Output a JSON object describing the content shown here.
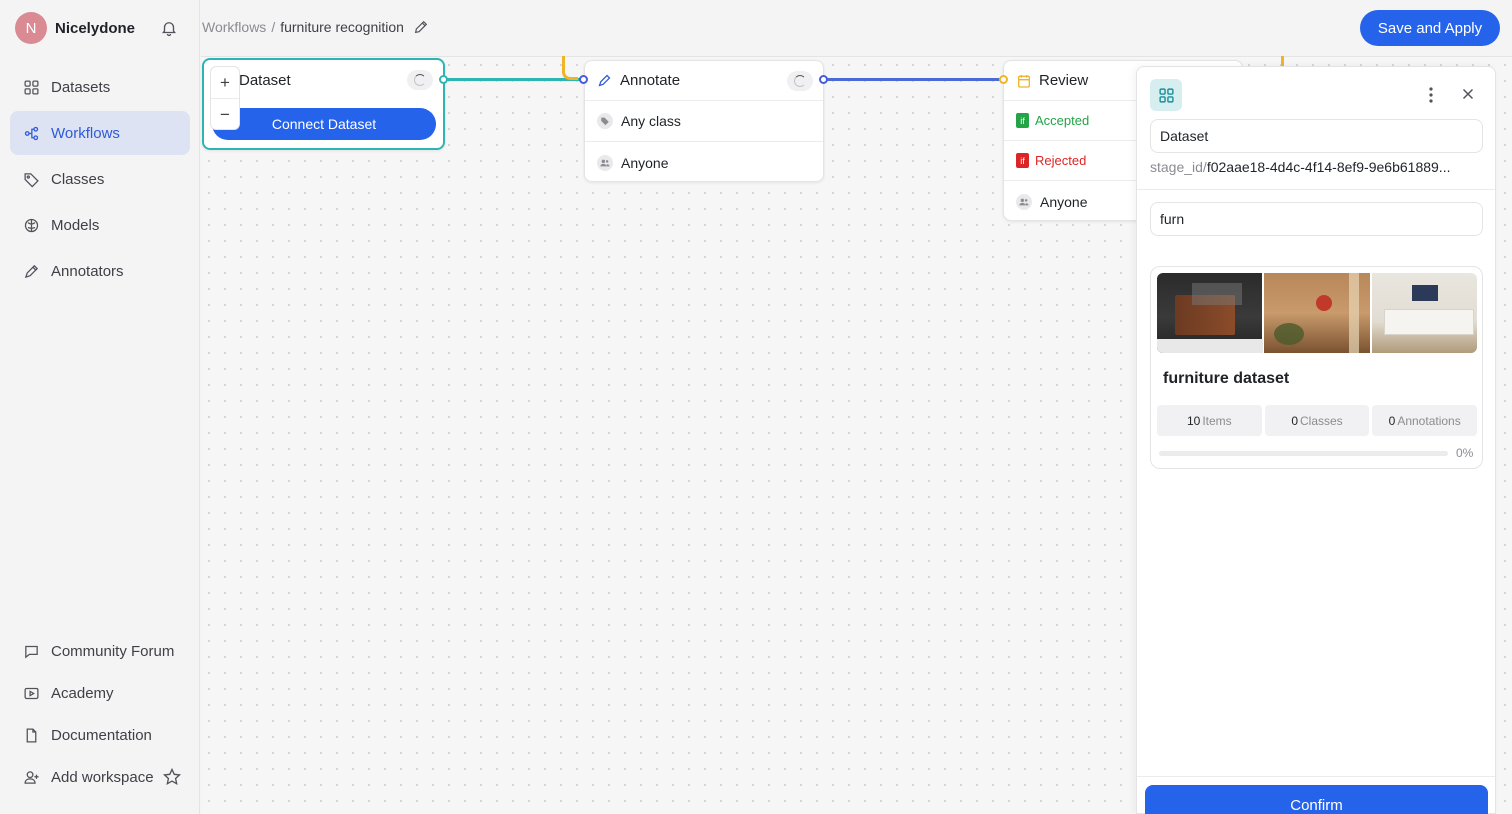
{
  "profile": {
    "initial": "N",
    "name": "Nicelydone"
  },
  "sidebar": {
    "items": [
      {
        "label": "Datasets",
        "icon": "grid-icon"
      },
      {
        "label": "Workflows",
        "icon": "workflow-icon",
        "active": true
      },
      {
        "label": "Classes",
        "icon": "tag-icon"
      },
      {
        "label": "Models",
        "icon": "brain-icon"
      },
      {
        "label": "Annotators",
        "icon": "pen-icon"
      }
    ],
    "bottom_items": [
      {
        "label": "Community Forum",
        "icon": "chat-icon"
      },
      {
        "label": "Academy",
        "icon": "play-icon"
      },
      {
        "label": "Documentation",
        "icon": "document-icon"
      },
      {
        "label": "Add workspace",
        "icon": "user-plus-icon"
      }
    ]
  },
  "breadcrumb": {
    "root": "Workflows",
    "separator": "/",
    "current": "furniture recognition"
  },
  "header": {
    "save_label": "Save and Apply"
  },
  "zoom": {
    "in": "+",
    "out": "−"
  },
  "nodes": {
    "dataset": {
      "title": "Dataset",
      "button": "Connect Dataset"
    },
    "annotate": {
      "title": "Annotate",
      "row1": "Any class",
      "row2": "Anyone"
    },
    "review": {
      "title": "Review",
      "accepted": "Accepted",
      "rejected": "Rejected",
      "if_label": "if",
      "assignee": "Anyone"
    }
  },
  "panel": {
    "name_value": "Dataset",
    "stage_prefix": "stage_id/",
    "stage_id": "f02aae18-4d4c-4f14-8ef9-9e6b61889...",
    "search_value": "furn",
    "card": {
      "title": "furniture dataset",
      "items_count": "10",
      "items_label": "Items",
      "classes_count": "0",
      "classes_label": "Classes",
      "annotations_count": "0",
      "annotations_label": "Annotations",
      "progress_label": "0%",
      "progress": 0
    },
    "confirm_label": "Confirm"
  },
  "colors": {
    "accent": "#2563eb",
    "teal": "#2fb4b4",
    "review": "#f0b429",
    "accepted": "#22a447",
    "rejected": "#dc2626"
  }
}
